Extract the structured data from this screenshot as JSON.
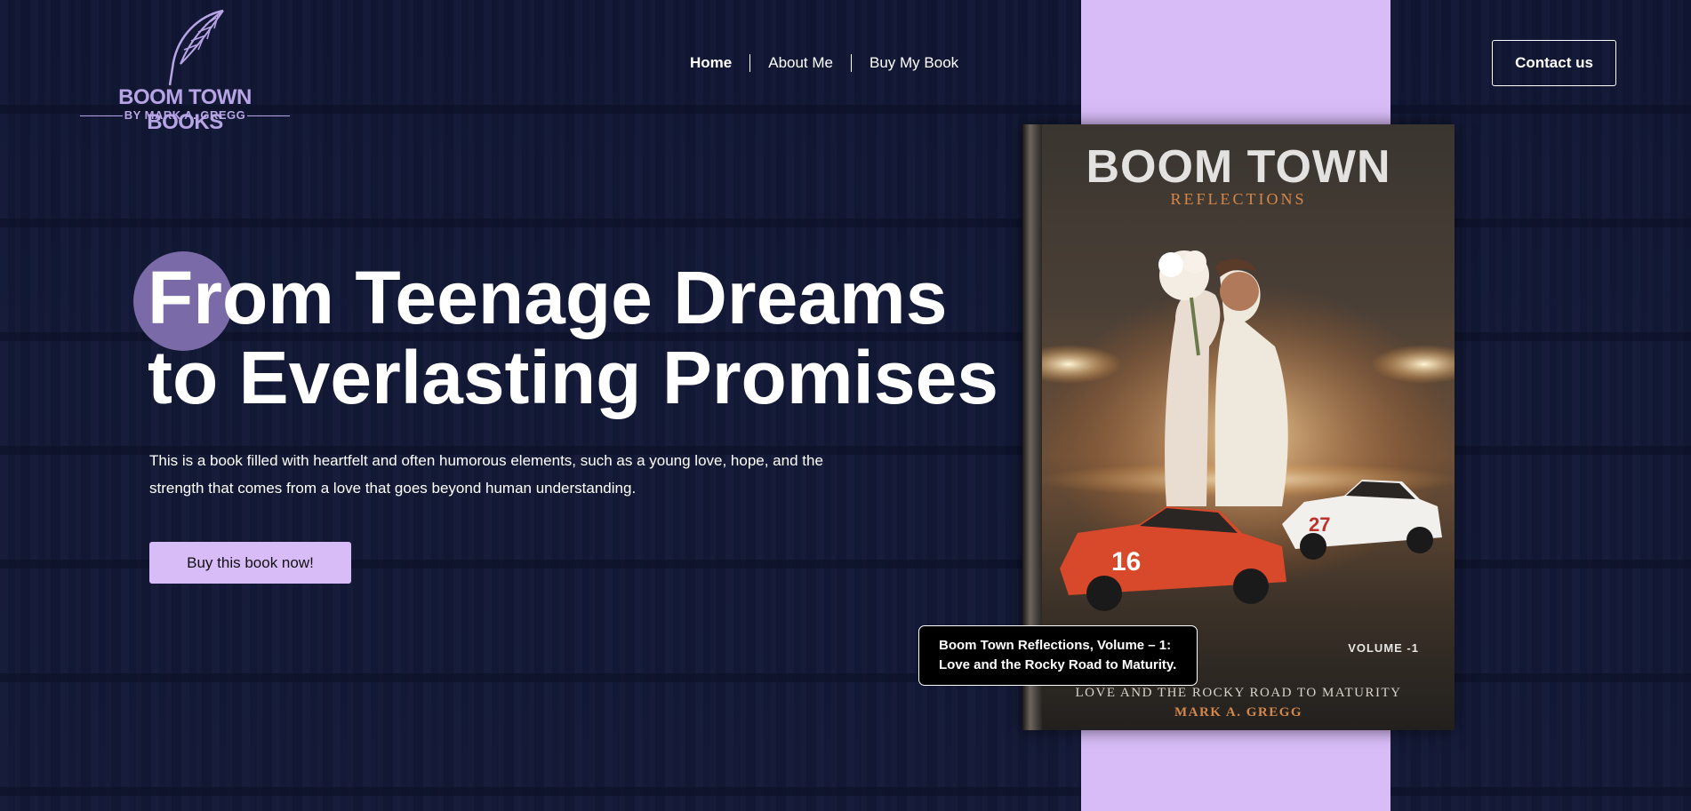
{
  "logo": {
    "title": "BOOM TOWN BOOKS",
    "subtitle": "BY MARK A. GREGG",
    "icon": "feather-icon",
    "color": "#b7a4e4"
  },
  "nav": {
    "items": [
      {
        "label": "Home",
        "active": true
      },
      {
        "label": "About Me",
        "active": false
      },
      {
        "label": "Buy My Book",
        "active": false
      }
    ]
  },
  "header": {
    "contact_label": "Contact us"
  },
  "hero": {
    "headline_line1": "From Teenage Dreams",
    "headline_line2": "to Everlasting Promises",
    "description": "This is a book filled with heartfelt and often humorous elements, such as a young love, hope, and the strength that comes from a love that goes beyond human understanding.",
    "cta_label": "Buy this book now!"
  },
  "book": {
    "title": "BOOM TOWN",
    "subtitle": "REFLECTIONS",
    "volume": "VOLUME -1",
    "tagline": "LOVE AND THE ROCKY ROAD TO MATURITY",
    "author": "MARK A. GREGG"
  },
  "tooltip": {
    "line1": "Boom Town Reflections, Volume – 1:",
    "line2": "Love and the Rocky Road to Maturity."
  },
  "colors": {
    "background": "#141a36",
    "accent": "#d8bcf7",
    "circle": "#7a6ba8"
  }
}
